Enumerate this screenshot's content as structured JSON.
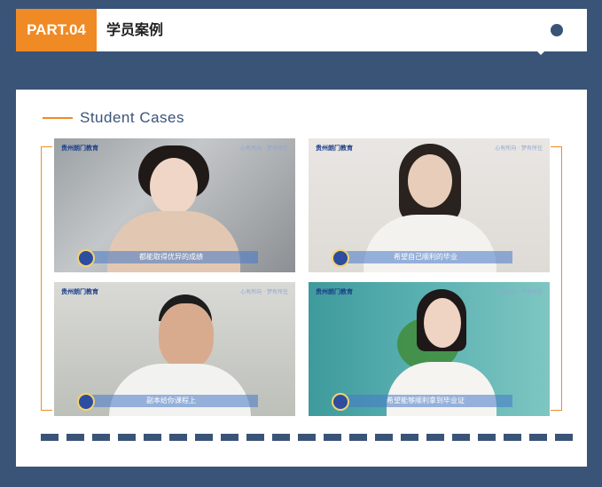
{
  "header": {
    "badge": "PART.04",
    "title": "学员案例"
  },
  "section": {
    "title": "Student Cases"
  },
  "cases": [
    {
      "logo": "贵州朗门教育",
      "tag": "心有所向 · 梦有所往",
      "caption": "都能取得优异的成绩"
    },
    {
      "logo": "贵州朗门教育",
      "tag": "心有所向 · 梦有所往",
      "caption": "希望自己顺利的毕业"
    },
    {
      "logo": "贵州朗门教育",
      "tag": "心有所向 · 梦有所往",
      "caption": "副本给你课程上"
    },
    {
      "logo": "贵州朗门教育",
      "tag": "心有所向 · 梦有所往",
      "caption": "希望能够顺利拿到毕业证"
    }
  ],
  "colors": {
    "accent": "#f08a24",
    "navy": "#3a5478"
  },
  "pagination_segments": 21
}
